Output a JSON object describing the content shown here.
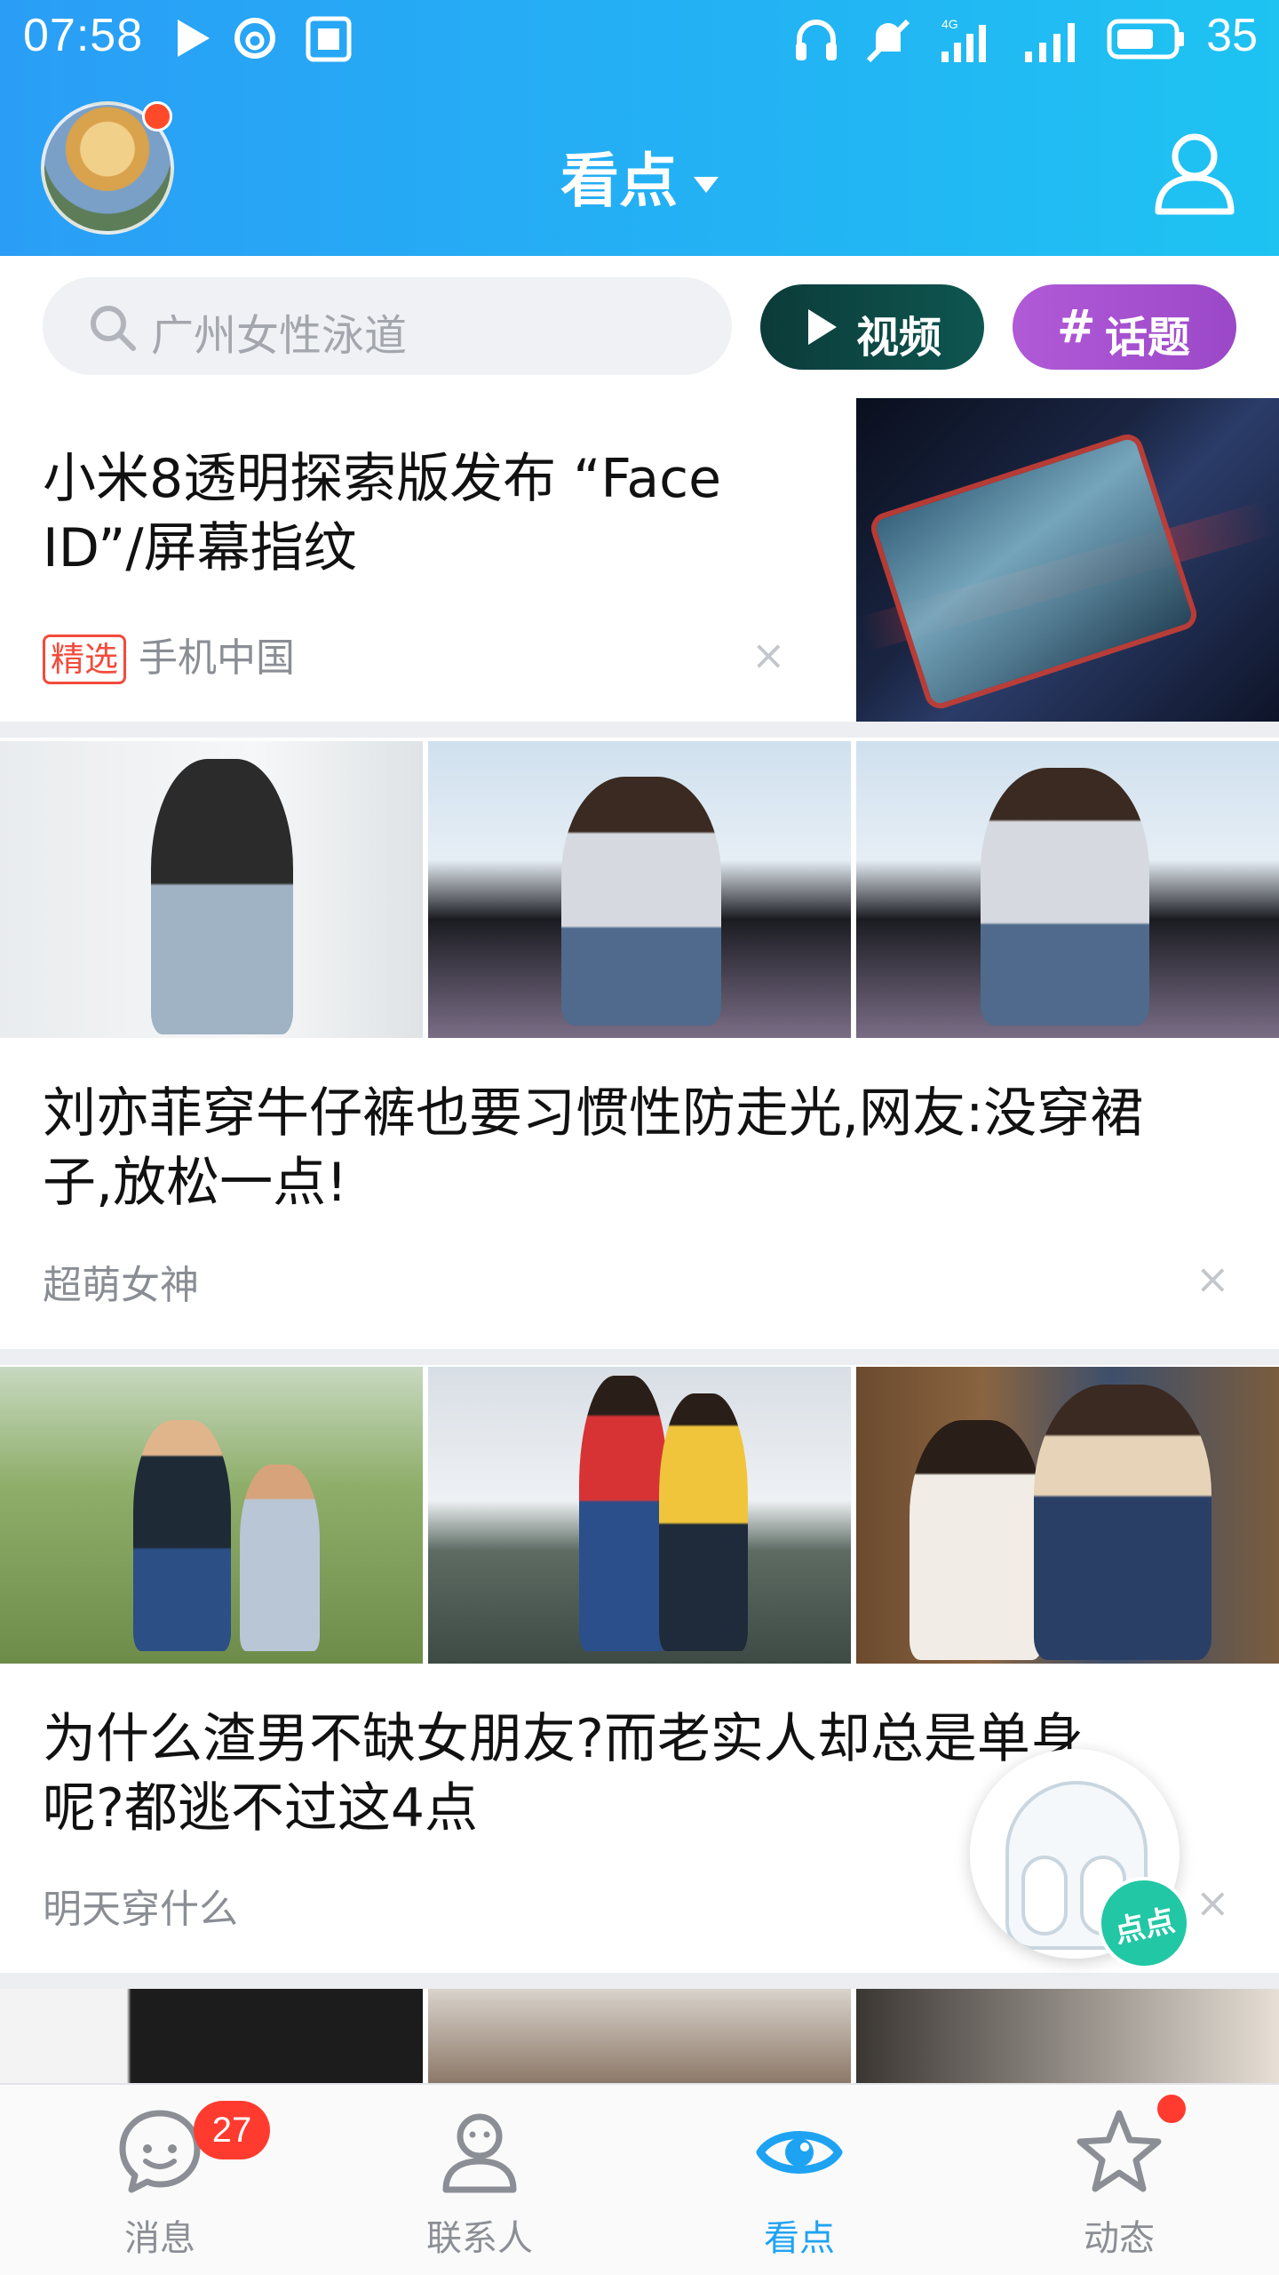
{
  "status_bar": {
    "time": "07:58",
    "battery": "35",
    "icons": [
      "play-icon",
      "netease-music-icon",
      "tieba-icon",
      "headphones-icon",
      "mute-icon",
      "signal-4g-icon",
      "signal-icon",
      "battery-icon"
    ]
  },
  "header": {
    "title": "看点",
    "avatar_has_notification": true
  },
  "search": {
    "placeholder": "广州女性泳道"
  },
  "pills": {
    "video_label": "视频",
    "topic_hash": "#",
    "topic_label": "话题"
  },
  "articles": [
    {
      "headline_line1": "小米8透明探索版发布 “Face",
      "headline_line2": "ID”/屏幕指纹",
      "tag": "精选",
      "source": "手机中国",
      "dismiss": "×"
    },
    {
      "headline_line1": "刘亦菲穿牛仔裤也要习惯性防走光,网友:没穿裙",
      "headline_line2": "子,放松一点!",
      "source": "超萌女神",
      "dismiss": "×"
    },
    {
      "headline_line1": "为什么渣男不缺女朋友?而老实人却总是单身",
      "headline_line2": "呢?都逃不过这4点",
      "source": "明天穿什么",
      "dismiss": "×"
    }
  ],
  "mascot": {
    "badge": "点点"
  },
  "nav": [
    {
      "label": "消息",
      "icon": "message-bubble-icon",
      "badge": "27"
    },
    {
      "label": "联系人",
      "icon": "contacts-person-icon"
    },
    {
      "label": "看点",
      "icon": "eye-icon",
      "active": true
    },
    {
      "label": "动态",
      "icon": "star-icon",
      "dot": true
    }
  ],
  "colors": {
    "header_gradient_start": "#2a9ef6",
    "header_gradient_end": "#1ec3f2",
    "active_nav": "#1ea3f3",
    "badge_red": "#ff3b30",
    "tag_red": "#f24b3c"
  }
}
